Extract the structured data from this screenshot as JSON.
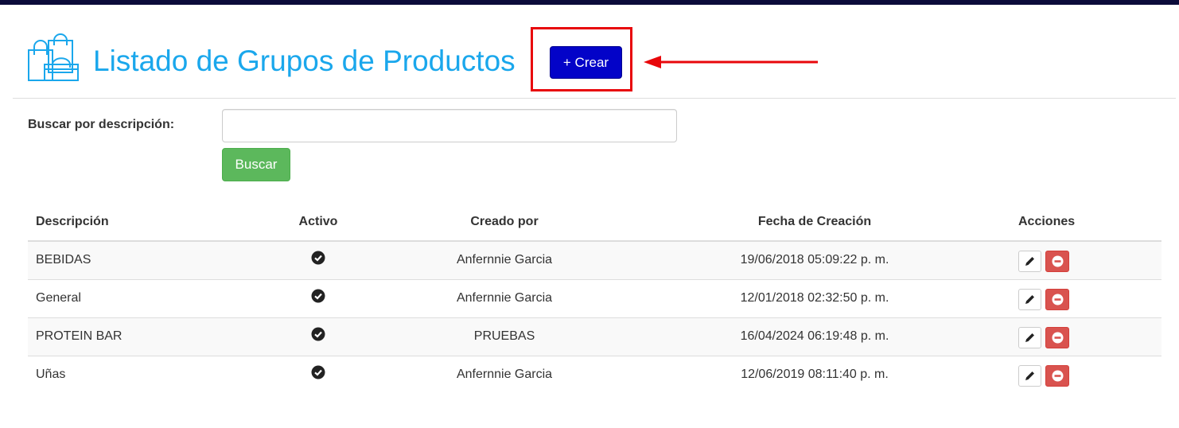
{
  "header": {
    "title": "Listado de Grupos de Productos",
    "create_label": "+ Crear",
    "icon": "shopping-bags-icon"
  },
  "search": {
    "label": "Buscar por descripción:",
    "value": "",
    "placeholder": "",
    "button_label": "Buscar"
  },
  "table": {
    "columns": {
      "description": "Descripción",
      "active": "Activo",
      "created_by": "Creado por",
      "created_date": "Fecha de Creación",
      "actions": "Acciones"
    },
    "rows": [
      {
        "description": "BEBIDAS",
        "active": true,
        "created_by": "Anfernnie Garcia",
        "created_date": "19/06/2018 05:09:22 p. m."
      },
      {
        "description": "General",
        "active": true,
        "created_by": "Anfernnie Garcia",
        "created_date": "12/01/2018 02:32:50 p. m."
      },
      {
        "description": "PROTEIN BAR",
        "active": true,
        "created_by": "PRUEBAS",
        "created_date": "16/04/2024 06:19:48 p. m."
      },
      {
        "description": "Uñas",
        "active": true,
        "created_by": "Anfernnie Garcia",
        "created_date": "12/06/2019 08:11:40 p. m."
      }
    ]
  },
  "colors": {
    "title": "#1aa7ec",
    "create_button": "#0303c8",
    "search_button": "#5cb85c",
    "delete_button": "#d9534f",
    "annotation": "#e8070b",
    "topbar": "#0b0b3a"
  },
  "icons": {
    "active": "check-circle-icon",
    "edit": "pencil-icon",
    "delete": "minus-circle-icon"
  }
}
